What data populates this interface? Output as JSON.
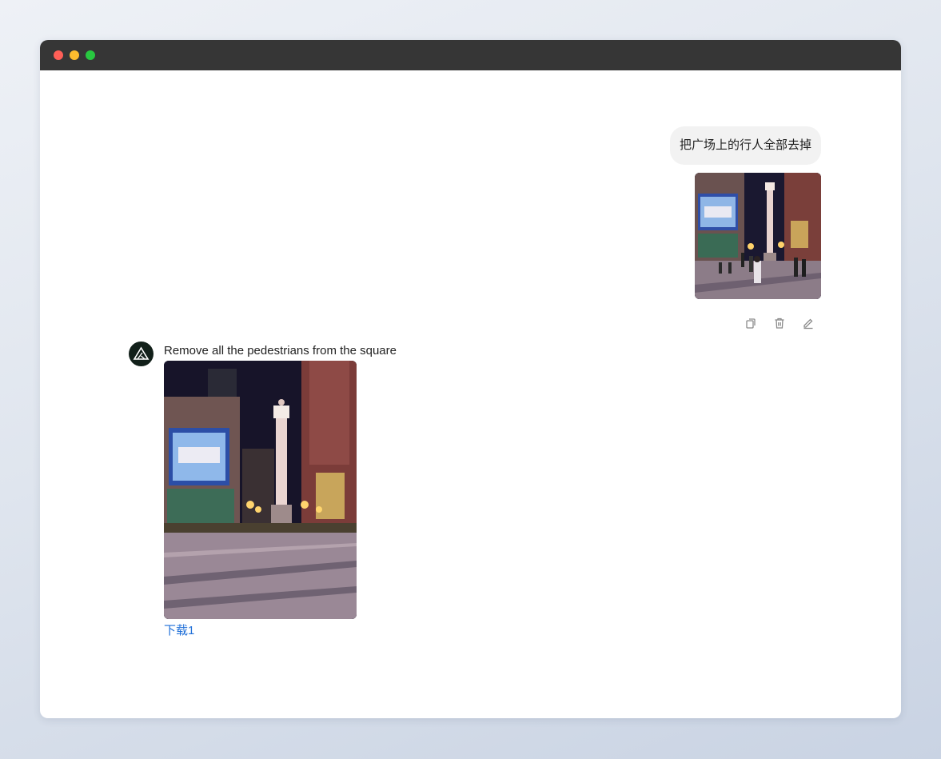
{
  "window": {
    "controls": [
      "close",
      "minimize",
      "maximize"
    ]
  },
  "chat": {
    "user_message": {
      "text": "把广场上的行人全部去掉",
      "attachment_icon": "image-thumbnail"
    },
    "actions": [
      {
        "icon": "copy-icon"
      },
      {
        "icon": "trash-icon"
      },
      {
        "icon": "edit-icon"
      }
    ],
    "assistant_message": {
      "avatar_icon": "triangle-logo",
      "text": "Remove all the pedestrians from the square",
      "download_label": "下载1"
    }
  },
  "colors": {
    "titlebar": "#363636",
    "user_bubble": "#f2f2f2",
    "link": "#1f6fd8",
    "avatar": "#12201a"
  }
}
